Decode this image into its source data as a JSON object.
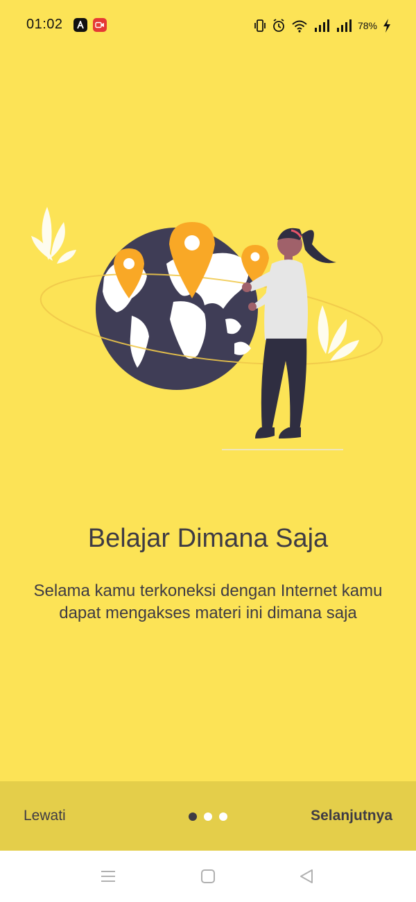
{
  "status_bar": {
    "time": "01:02",
    "battery": "78%",
    "icons": [
      "vibrate-icon",
      "alarm-icon",
      "wifi-icon",
      "signal-icon",
      "signal-icon",
      "charging-icon"
    ]
  },
  "onboarding": {
    "title": "Belajar Dimana Saja",
    "description": "Selama kamu terkoneksi dengan Internet kamu dapat mengakses materi ini dimana saja"
  },
  "actions": {
    "skip_label": "Lewati",
    "next_label": "Selanjutnya",
    "page_indicator": {
      "current": 1,
      "total": 3
    }
  },
  "colors": {
    "background": "#FCE356",
    "bottom_bar": "#E4CE4A",
    "text": "#3E3B44",
    "globe": "#3F3D56",
    "pin": "#F9A826"
  },
  "nav_bar": {
    "icons": [
      "menu-icon",
      "home-icon",
      "back-icon"
    ]
  }
}
